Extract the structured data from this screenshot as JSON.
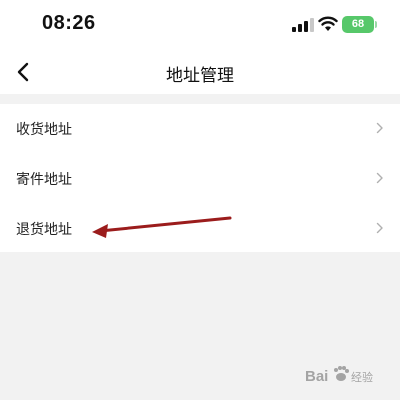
{
  "status_bar": {
    "time": "08:26",
    "battery": "68",
    "icons": [
      "cellular-signal-icon",
      "wifi-icon",
      "battery-icon"
    ]
  },
  "nav": {
    "back_icon": "chevron-left-icon",
    "title": "地址管理"
  },
  "list": {
    "items": [
      {
        "label": "收货地址",
        "icon": "chevron-right-icon"
      },
      {
        "label": "寄件地址",
        "icon": "chevron-right-icon"
      },
      {
        "label": "退货地址",
        "icon": "chevron-right-icon"
      }
    ]
  },
  "annotation": {
    "arrow_color": "#9b1c1c",
    "points_to": "退货地址"
  },
  "watermark": {
    "text": "Baidu经验"
  },
  "colors": {
    "background": "#f2f2f2",
    "surface": "#ffffff",
    "battery": "#57c86a",
    "chevron": "#b0b0b0"
  }
}
